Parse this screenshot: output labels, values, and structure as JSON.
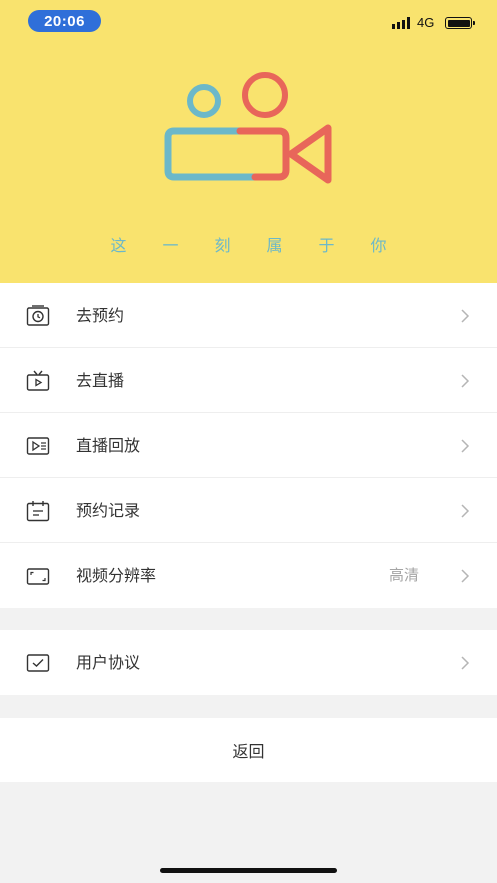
{
  "status_bar": {
    "time": "20:06",
    "network": "4G"
  },
  "hero": {
    "background": "#f9e36e",
    "slogan": "这一刻属于你",
    "logo_colors": {
      "blue": "#6cb8c9",
      "red": "#e8665a"
    }
  },
  "menu": {
    "items": [
      {
        "label": "去预约",
        "icon": "alarm-clock-icon"
      },
      {
        "label": "去直播",
        "icon": "tv-play-icon"
      },
      {
        "label": "直播回放",
        "icon": "playback-icon"
      },
      {
        "label": "预约记录",
        "icon": "calendar-icon"
      },
      {
        "label": "视频分辨率",
        "value": "高清",
        "icon": "resolution-icon"
      }
    ]
  },
  "agreement": {
    "label": "用户协议",
    "icon": "checkbox-icon"
  },
  "back_label": "返回"
}
